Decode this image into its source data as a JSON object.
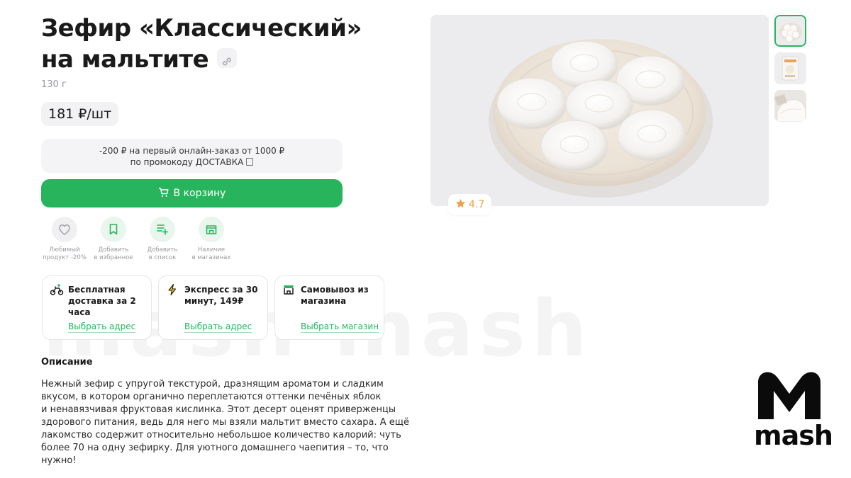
{
  "product": {
    "title_line1": "Зефир «Классический»",
    "title_line2": "на мальтите",
    "weight": "130 г",
    "price": "181 ₽/шт",
    "rating": "4.7"
  },
  "promo": {
    "line1": "-200 ₽ на первый онлайн-заказ от 1000 ₽",
    "line2": "по промокоду ДОСТАВКА"
  },
  "cart_button": "В корзину",
  "actions": [
    {
      "icon": "heart-icon",
      "label1": "Любимый",
      "label2": "продукт -20%"
    },
    {
      "icon": "bookmark-icon",
      "label1": "Добавить",
      "label2": "в избранное"
    },
    {
      "icon": "list-add-icon",
      "label1": "Добавить",
      "label2": "в список"
    },
    {
      "icon": "store-icon",
      "label1": "Наличие",
      "label2": "в магазинах"
    }
  ],
  "delivery": [
    {
      "icon": "courier-bike-icon",
      "text": "Бесплатная доставка за 2 часа",
      "link": "Выбрать адрес"
    },
    {
      "icon": "lightning-icon",
      "text": "Экспресс за 30 минут, 149₽",
      "link": "Выбрать адрес"
    },
    {
      "icon": "shop-icon",
      "text": "Самовывоз из магазина",
      "link": "Выбрать магазин"
    }
  ],
  "description": {
    "heading": "Описание",
    "lines": [
      "Нежный зефир с упругой текстурой, дразнящим ароматом и сладким",
      "вкусом, в котором органично переплетаются оттенки печёных яблок",
      "и ненавязчивая фруктовая кислинка. Этот десерт оценят приверженцы",
      "здорового питания, ведь для него мы взяли мальтит вместо сахара. А ещё",
      "лакомство содержит относительно небольшое количество калорий: чуть",
      "более 70 на одну зефирку. Для уютного домашнего чаепития – то, что",
      "нужно!"
    ]
  },
  "watermark": {
    "text": "mash mash",
    "logo_text": "mash"
  },
  "colors": {
    "accent": "#28b45d",
    "rating_star": "#f0a046"
  }
}
